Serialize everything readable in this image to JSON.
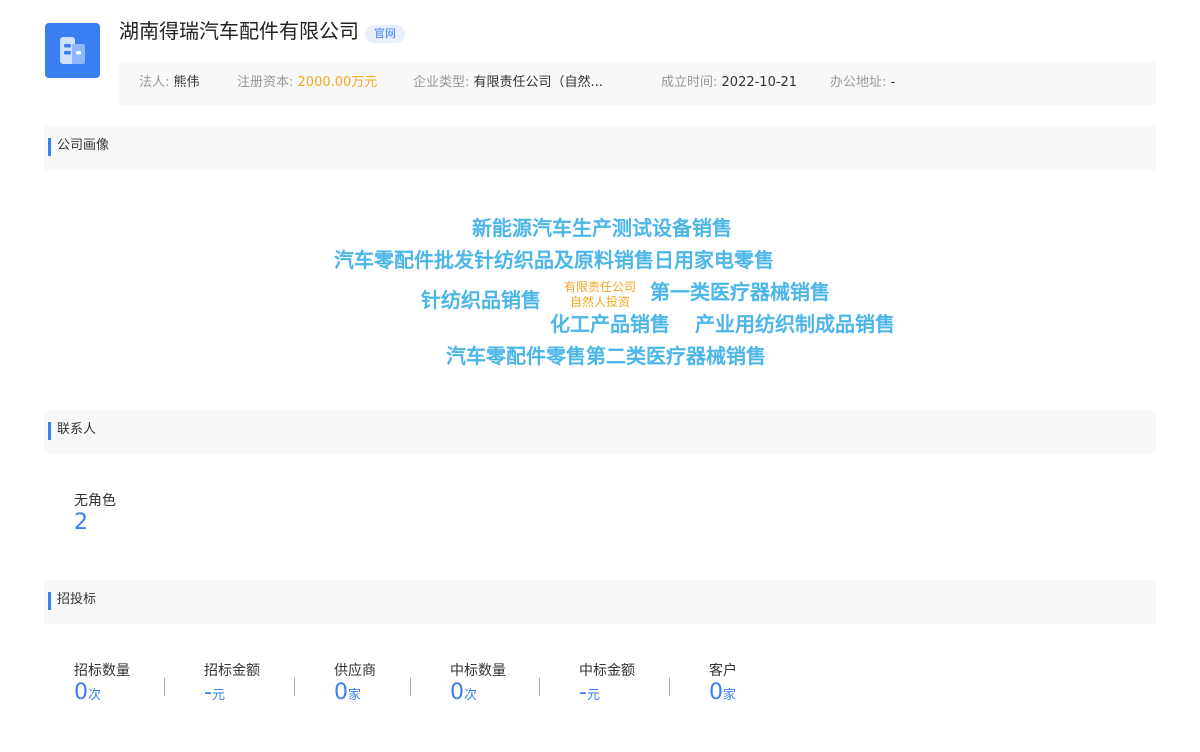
{
  "header": {
    "company_name": "湖南得瑞汽车配件有限公司",
    "official_tag": "官网",
    "icon": "building-icon",
    "info": {
      "legal_rep_label": "法人:",
      "legal_rep": "熊伟",
      "capital_label": "注册资本:",
      "capital": "2000.00万元",
      "type_label": "企业类型:",
      "type": "有限责任公司（自然...",
      "founded_label": "成立时间:",
      "founded": "2022-10-21",
      "address_label": "办公地址:",
      "address": "-"
    }
  },
  "portrait": {
    "title": "公司画像",
    "words": [
      "新能源汽车生产测试设备销售",
      "汽车零配件批发针纺织品及原料销售日用家电零售",
      "针纺织品销售",
      "第一类医疗器械销售",
      "化工产品销售",
      "产业用纺织制成品销售",
      "汽车零配件零售第二类医疗器械销售"
    ],
    "tag_line1": "有限责任公司",
    "tag_line2": "自然人投资"
  },
  "contacts": {
    "title": "联系人",
    "role_label": "无角色",
    "role_count": "2"
  },
  "bidding": {
    "title": "招投标",
    "stats": [
      {
        "label": "招标数量",
        "value": "0",
        "unit": "次"
      },
      {
        "label": "招标金额",
        "value": "-",
        "unit": "元"
      },
      {
        "label": "供应商",
        "value": "0",
        "unit": "家"
      },
      {
        "label": "中标数量",
        "value": "0",
        "unit": "次"
      },
      {
        "label": "中标金额",
        "value": "-",
        "unit": "元"
      },
      {
        "label": "客户",
        "value": "0",
        "unit": "家"
      }
    ]
  },
  "colors": {
    "accent": "#3a7ff2",
    "word_cloud": "#4db6e9",
    "highlight": "#f5a623"
  }
}
